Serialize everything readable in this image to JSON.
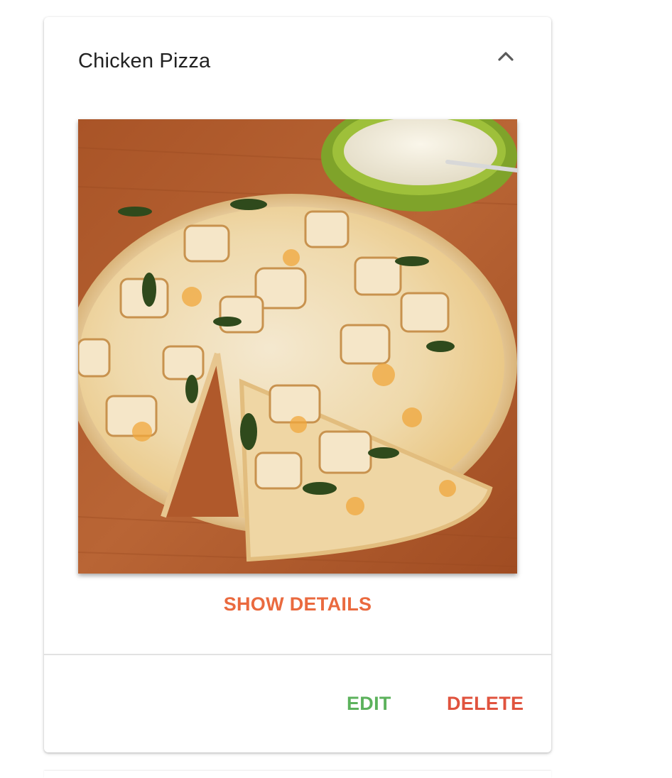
{
  "card": {
    "title": "Chicken Pizza",
    "collapse_icon": "chevron-up-icon",
    "photo_alt": "Chicken Pizza",
    "show_details_label": "SHOW DETAILS",
    "edit_label": "EDIT",
    "delete_label": "DELETE"
  },
  "colors": {
    "show_details": "#ea6a3f",
    "edit": "#5cb25c",
    "delete": "#e0533e",
    "title": "#222222",
    "divider": "#e2e2e2"
  }
}
